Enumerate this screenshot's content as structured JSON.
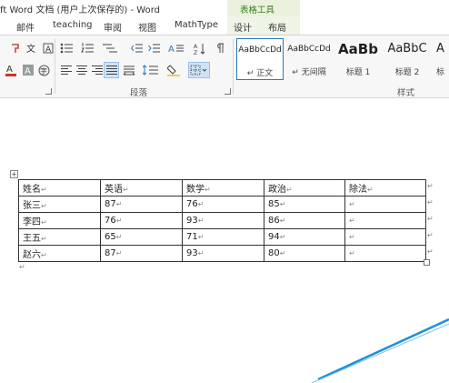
{
  "window": {
    "title": "ft Word 文档 (用户上次保存的) - Word",
    "context_group": "表格工具"
  },
  "tabs": [
    "邮件",
    "teaching",
    "审阅",
    "视图",
    "MathType",
    "设计",
    "布局"
  ],
  "ribbon": {
    "paragraph_label": "段落",
    "styles_label": "样式",
    "styles": [
      {
        "preview": "AaBbCcDd",
        "name": "正文",
        "prefix": "↵"
      },
      {
        "preview": "AaBbCcDd",
        "name": "无间隔",
        "prefix": "↵"
      },
      {
        "preview": "AaBb",
        "name": "标题 1"
      },
      {
        "preview": "AaBbC",
        "name": "标题 2"
      },
      {
        "preview": "A",
        "name": "标"
      }
    ]
  },
  "table": {
    "headers": [
      "姓名",
      "英语",
      "数学",
      "政治",
      "除法"
    ],
    "rows": [
      [
        "张三",
        "87",
        "76",
        "85",
        ""
      ],
      [
        "李四",
        "76",
        "93",
        "86",
        ""
      ],
      [
        "王五",
        "65",
        "71",
        "94",
        ""
      ],
      [
        "赵六",
        "87",
        "93",
        "80",
        ""
      ]
    ],
    "cell_mark": "↵"
  },
  "colors": {
    "accent": "#2b78c2",
    "context_tab": "#3a7d22",
    "font_red": "#d0342c",
    "diagonal_line": "#1e8fd6"
  }
}
